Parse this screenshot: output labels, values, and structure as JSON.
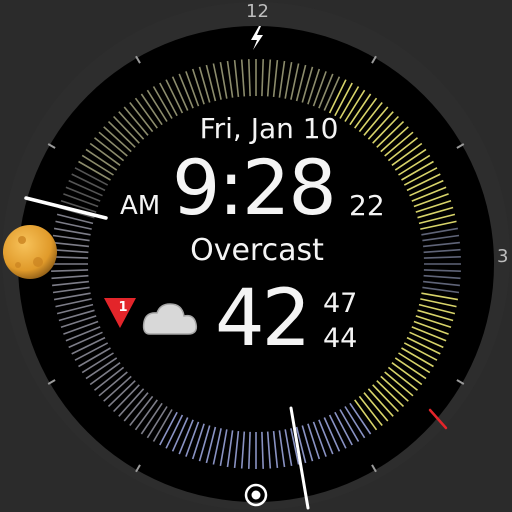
{
  "bezel": {
    "mark_12": "12",
    "mark_3": "3"
  },
  "date_text": "Fri, Jan 10",
  "time": {
    "ampm": "AM",
    "hm": "9:28",
    "seconds": "22"
  },
  "weather": {
    "condition": "Overcast",
    "temp": "42",
    "high": "47",
    "low": "44",
    "alert_count": "1"
  },
  "icons": {
    "top": "lightning-bolt-icon",
    "left": "moon-phase-icon",
    "weather": "cloud-icon",
    "alert": "warning-triangle-icon",
    "bottom": "target-icon"
  },
  "colors": {
    "yellow_arc": "#d8d46a",
    "blue_arc": "#8a93c4",
    "hand": "#f4f4f4",
    "alert_red": "#e3252a",
    "moon": "#e6a532"
  }
}
